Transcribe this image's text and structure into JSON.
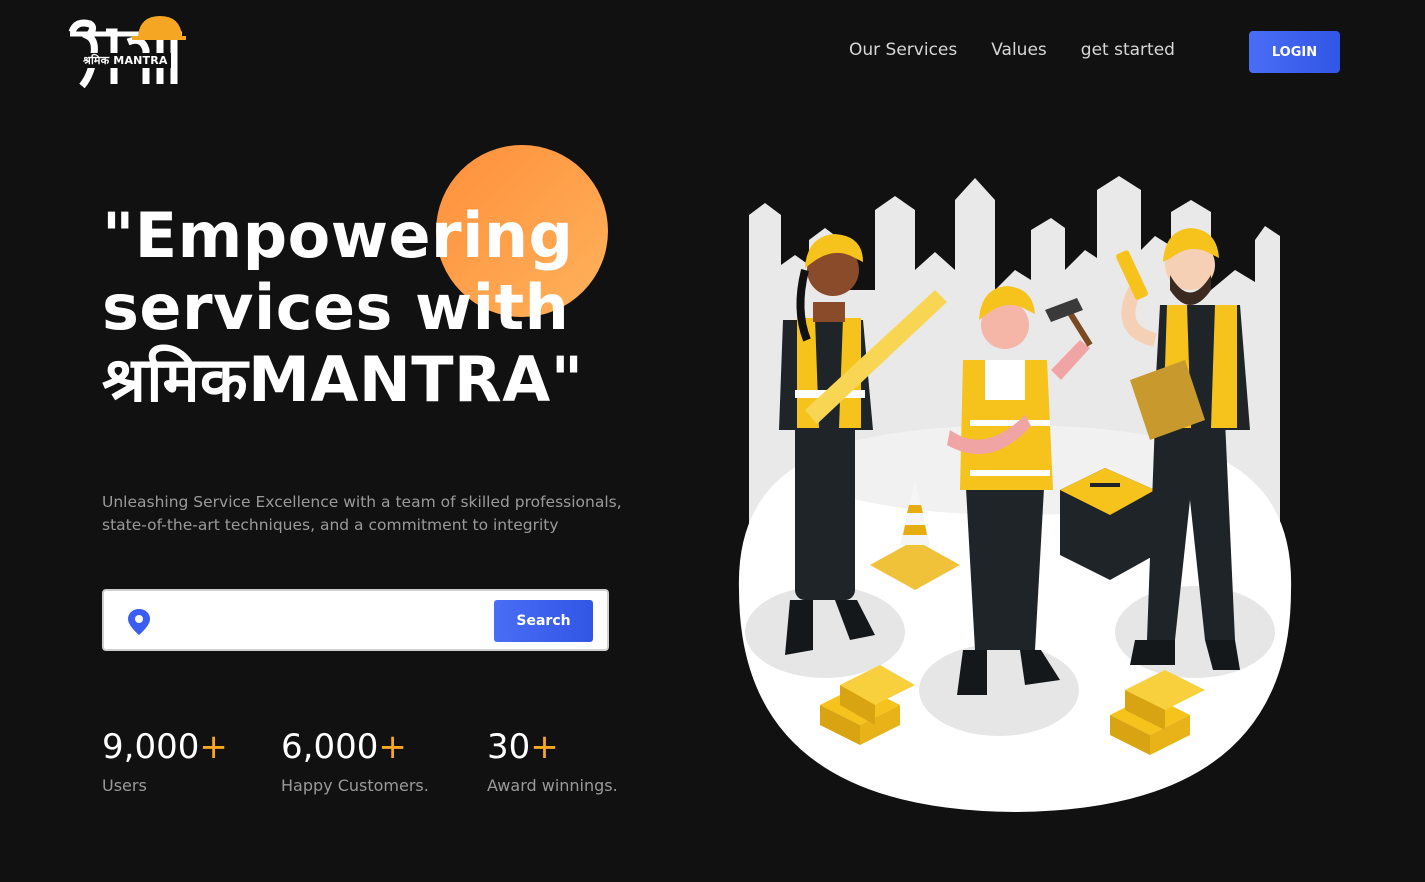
{
  "brand": {
    "logo_text": "श्रमिक MANTRA",
    "logo_icon": "hardhat-logo-icon"
  },
  "nav": {
    "items": [
      {
        "label": "Our Services"
      },
      {
        "label": "Values"
      },
      {
        "label": "get started"
      }
    ],
    "login_label": "LOGIN"
  },
  "hero": {
    "title_line1": "\"Empowering",
    "title_line2": "services with",
    "title_line3": "श्रमिकMANTRA\"",
    "subtitle": "Unleashing Service Excellence with a team of skilled professionals, state-of-the-art techniques, and a commitment to integrity"
  },
  "search": {
    "icon": "location-pin-icon",
    "value": "",
    "button_label": "Search"
  },
  "stats": [
    {
      "number": "9,000",
      "suffix": "+",
      "label": "Users"
    },
    {
      "number": "6,000",
      "suffix": "+",
      "label": "Happy Customers."
    },
    {
      "number": "30",
      "suffix": "+",
      "label": "Award winnings."
    }
  ],
  "colors": {
    "background": "#121111",
    "accent_blue": "#3b5ef0",
    "accent_orange": "#ff9a45",
    "plus_orange": "#f5a623",
    "helmet_yellow": "#f6c21c"
  }
}
